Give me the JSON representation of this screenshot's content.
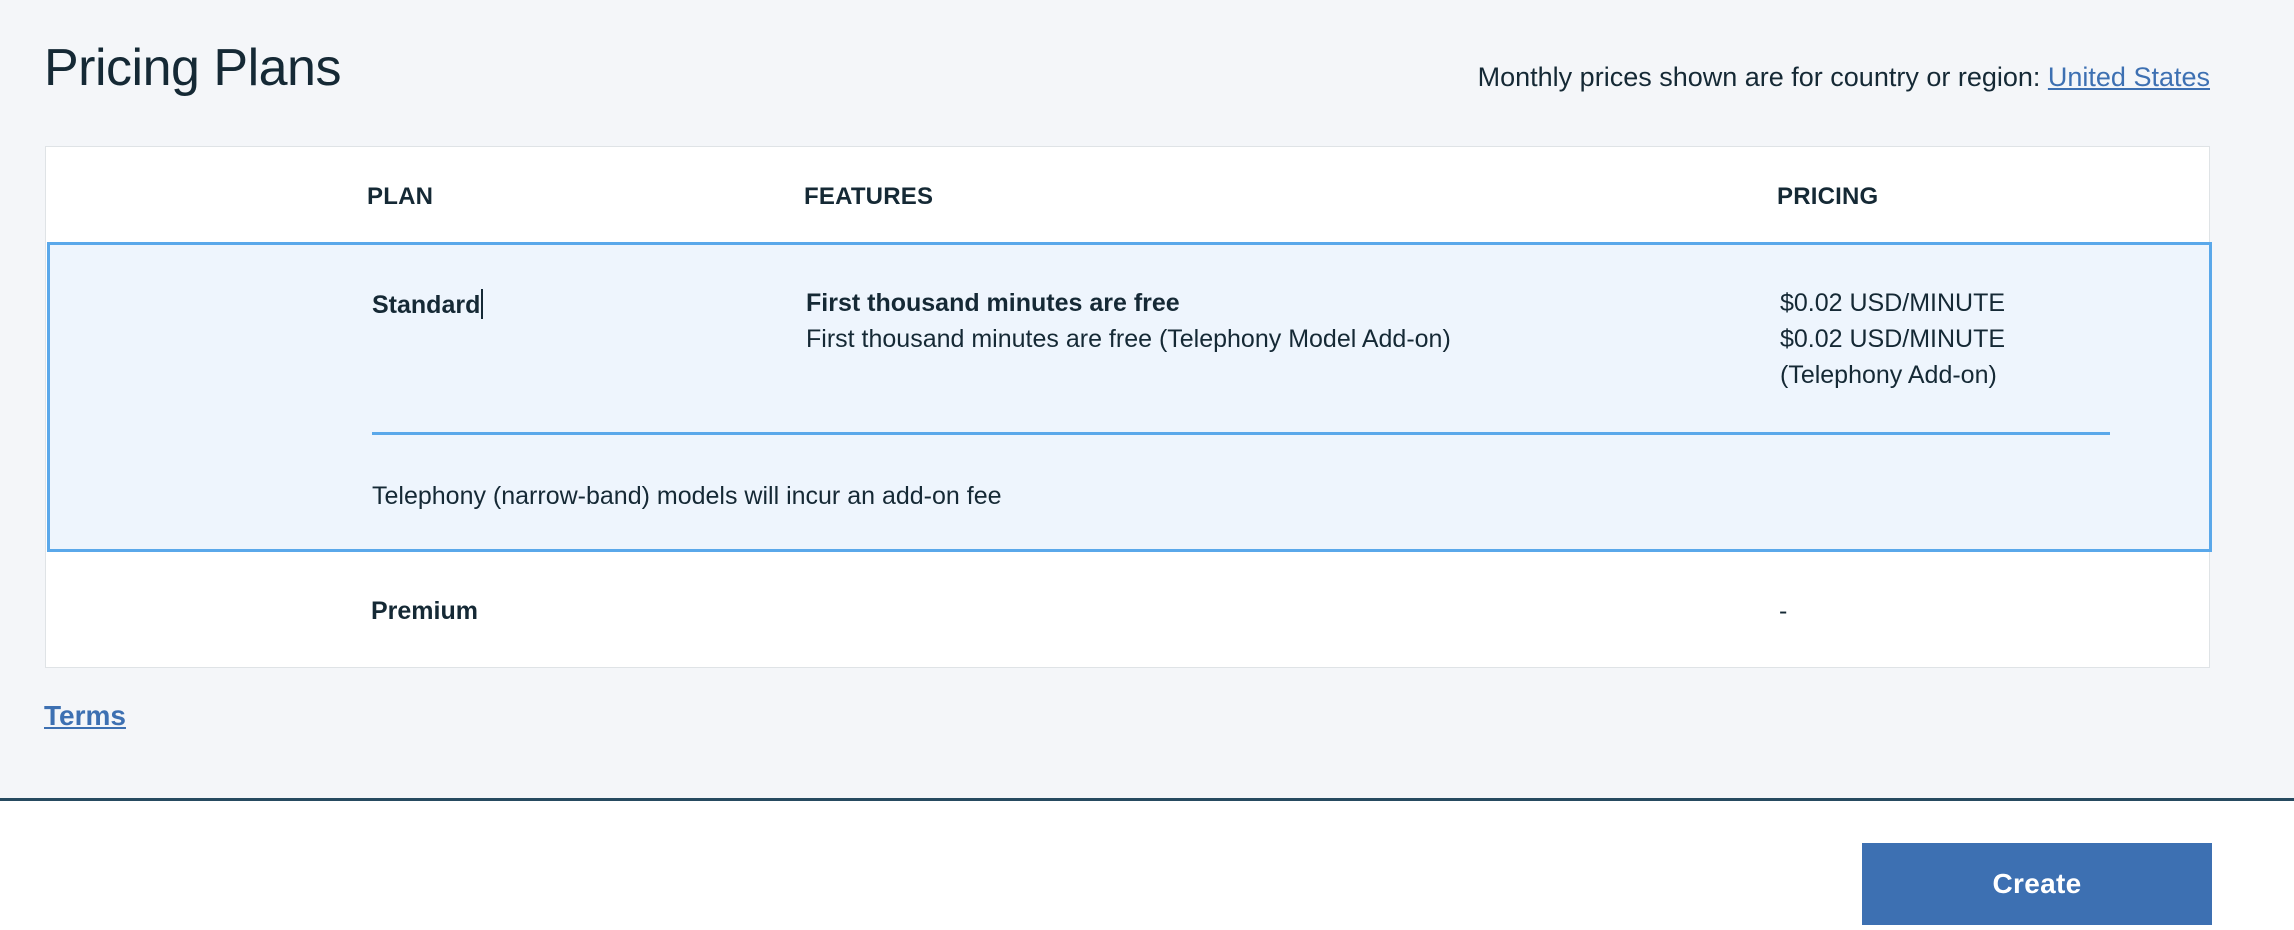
{
  "header": {
    "title": "Pricing Plans",
    "region_prefix": "Monthly prices shown are for country or region: ",
    "region_link": "United States"
  },
  "table": {
    "columns": {
      "plan": "PLAN",
      "features": "FEATURES",
      "pricing": "PRICING"
    },
    "rows": [
      {
        "plan": "Standard",
        "selected": true,
        "features": [
          "First thousand minutes are free",
          "First thousand minutes are free (Telephony Model Add-on)"
        ],
        "pricing": [
          "$0.02 USD/MINUTE",
          "$0.02 USD/MINUTE",
          "(Telephony Add-on)"
        ],
        "note": "Telephony (narrow-band) models will incur an add-on fee"
      },
      {
        "plan": "Premium",
        "selected": false,
        "features": [],
        "pricing": [
          "-"
        ]
      }
    ]
  },
  "links": {
    "terms": "Terms"
  },
  "footer": {
    "create_label": "Create"
  },
  "colors": {
    "accent": "#3d70b2",
    "selection_border": "#5aa8ea",
    "selection_background": "#eef5fd",
    "text": "#152935"
  }
}
